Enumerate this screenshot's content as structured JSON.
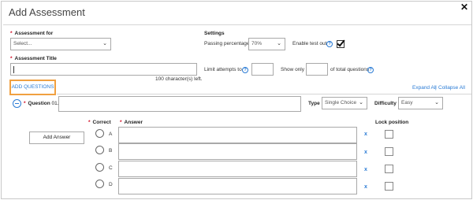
{
  "dialog": {
    "title": "Add Assessment",
    "close_icon": "close-icon"
  },
  "assessment_for": {
    "label": "Assessment for",
    "required_mark": "*",
    "value": "Select..."
  },
  "assessment_title": {
    "label": "Assessment Title",
    "required_mark": "*",
    "value": "",
    "char_count": "100 character(s) left."
  },
  "settings": {
    "heading": "Settings",
    "passing_label": "Passing percentage",
    "passing_value": "70%",
    "enable_test_out_label": "Enable test out",
    "enable_test_out_checked": true,
    "limit_attempts_label": "Limit attempts to",
    "limit_attempts_value": "",
    "show_only_label": "Show only",
    "show_only_value": "",
    "of_total_label": "of total questions"
  },
  "add_questions_label": "ADD QUESTIONS",
  "expand_all": "Expand All",
  "separator": "|",
  "collapse_all": "Collapse All",
  "question": {
    "required_mark": "*",
    "label": "Question",
    "number": "01.",
    "value": "",
    "type_label": "Type",
    "type_value": "Single Choice",
    "difficulty_label": "Difficulty",
    "difficulty_value": "Easy"
  },
  "answers": {
    "correct_header": "Correct",
    "answer_header": "Answer",
    "required_mark": "*",
    "lock_header": "Lock position",
    "add_answer_label": "Add Answer",
    "remove_label": "x",
    "options": [
      {
        "letter": "A",
        "value": ""
      },
      {
        "letter": "B",
        "value": ""
      },
      {
        "letter": "C",
        "value": ""
      },
      {
        "letter": "D",
        "value": ""
      }
    ]
  },
  "colors": {
    "accent": "#2a7bd5",
    "required": "#d0021b",
    "highlight": "#f0a040"
  }
}
